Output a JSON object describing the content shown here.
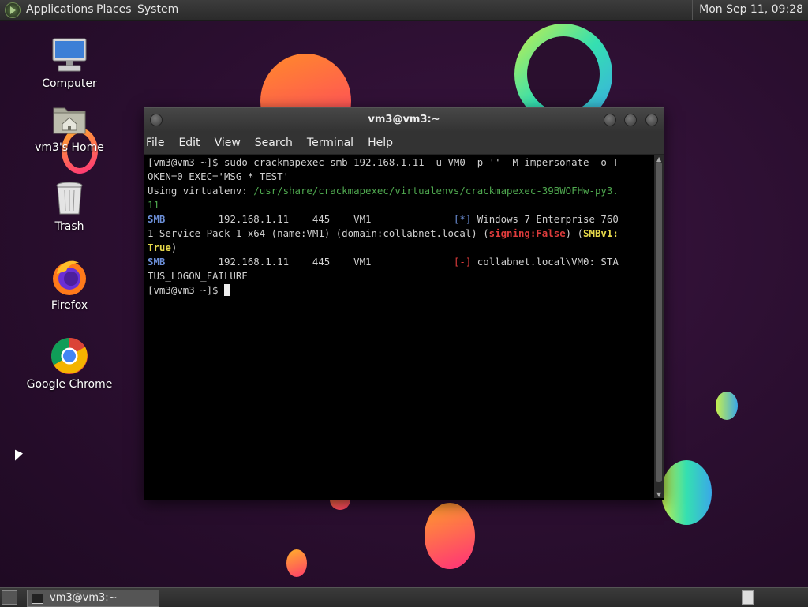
{
  "top_panel": {
    "menus": [
      "Applications",
      "Places",
      "System"
    ],
    "clock": "Mon Sep 11, 09:28"
  },
  "desktop_icons": [
    {
      "label": "Computer",
      "icon": "computer-icon"
    },
    {
      "label": "vm3's Home",
      "icon": "home-folder-icon"
    },
    {
      "label": "Trash",
      "icon": "trash-icon"
    },
    {
      "label": "Firefox",
      "icon": "firefox-icon"
    },
    {
      "label": "Google Chrome",
      "icon": "chrome-icon"
    }
  ],
  "window": {
    "title": "vm3@vm3:~",
    "menu": [
      "File",
      "Edit",
      "View",
      "Search",
      "Terminal",
      "Help"
    ]
  },
  "terminal": {
    "line1": "[vm3@vm3 ~]$ sudo crackmapexec smb 192.168.1.11 -u VM0 -p '' -M impersonate -o T",
    "line2": "OKEN=0 EXEC='MSG * TEST'",
    "line3_prefix": "Using virtualenv: ",
    "line3_path": "/usr/share/crackmapexec/virtualenvs/crackmapexec-39BWOFHw-py3.",
    "line4_path": "11",
    "row1_proto": "SMB",
    "row1_cols": "         192.168.1.11    445    VM1              ",
    "row1_flag": "[*]",
    "row1_text": " Windows 7 Enterprise 760",
    "line6a": "1 Service Pack 1 x64 (name:VM1) (domain:collabnet.local) (",
    "line6_signing": "signing:False",
    "line6b": ") (",
    "line6_smbv1": "SMBv1:",
    "line7_true": "True",
    "line7_close": ")",
    "row2_proto": "SMB",
    "row2_cols": "         192.168.1.11    445    VM1              ",
    "row2_flag": "[-]",
    "row2_text": " collabnet.local\\VM0: STA",
    "line9": "TUS_LOGON_FAILURE",
    "prompt": "[vm3@vm3 ~]$ "
  },
  "taskbar": {
    "task_label": "vm3@vm3:~"
  }
}
